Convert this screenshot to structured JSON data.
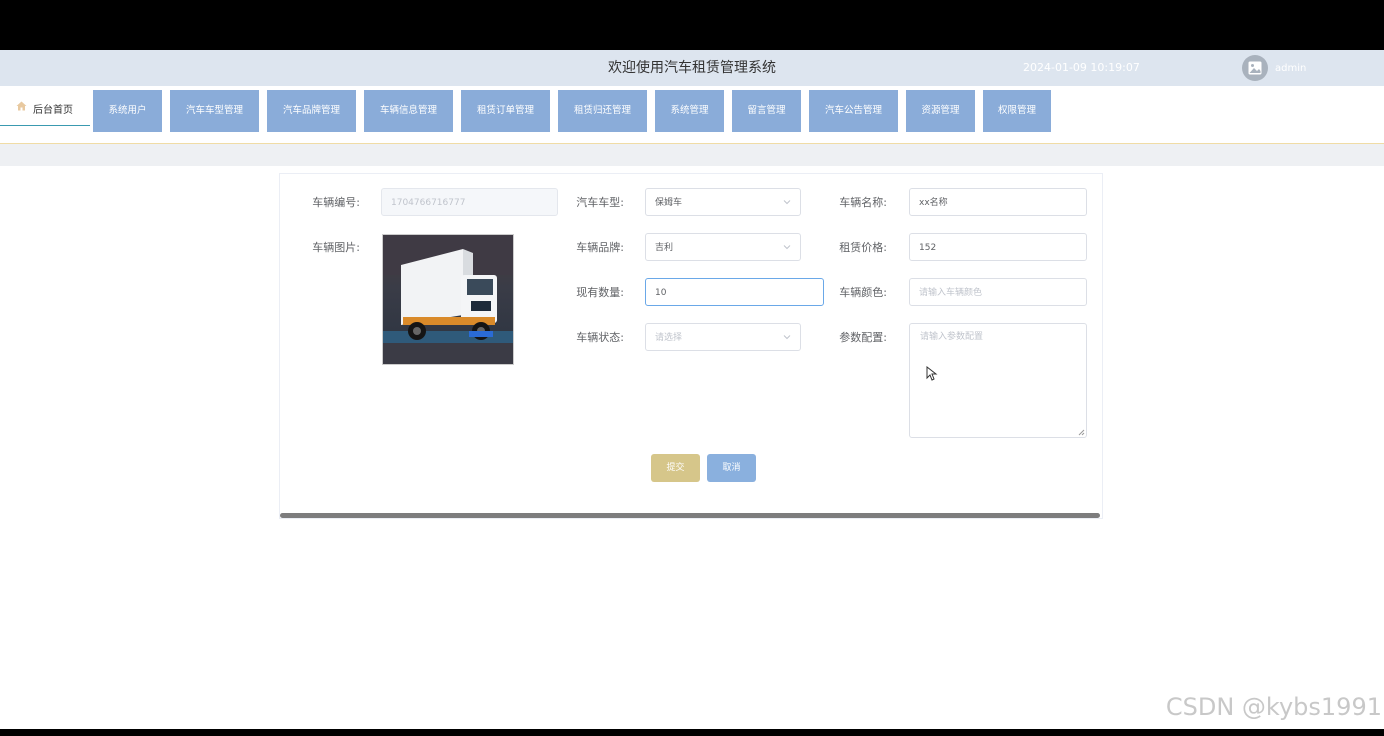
{
  "header": {
    "title": "欢迎使用汽车租赁管理系统",
    "datetime": "2024-01-09 10:19:07",
    "username": "admin"
  },
  "nav": {
    "home_label": "后台首页",
    "items": [
      "系统用户",
      "汽车车型管理",
      "汽车品牌管理",
      "车辆信息管理",
      "租赁订单管理",
      "租赁归还管理",
      "系统管理",
      "留言管理",
      "汽车公告管理",
      "资源管理",
      "权限管理"
    ]
  },
  "form": {
    "vehicle_no_label": "车辆编号:",
    "vehicle_no_value": "1704766716777",
    "car_type_label": "汽车车型:",
    "car_type_value": "保姆车",
    "vehicle_name_label": "车辆名称:",
    "vehicle_name_value": "xx名称",
    "vehicle_image_label": "车辆图片:",
    "brand_label": "车辆品牌:",
    "brand_value": "吉利",
    "rent_price_label": "租赁价格:",
    "rent_price_value": "152",
    "quantity_label": "现有数量:",
    "quantity_value": "10",
    "color_label": "车辆颜色:",
    "color_placeholder": "请输入车辆颜色",
    "status_label": "车辆状态:",
    "status_placeholder": "请选择",
    "config_label": "参数配置:",
    "config_placeholder": "请输入参数配置",
    "submit_label": "提交",
    "cancel_label": "取消"
  },
  "watermark": "CSDN @kybs1991",
  "colors": {
    "header_bg": "#dde5ef",
    "nav_button": "#8aacd9",
    "submit": "#d6c68a",
    "cancel": "#8ab0de"
  }
}
